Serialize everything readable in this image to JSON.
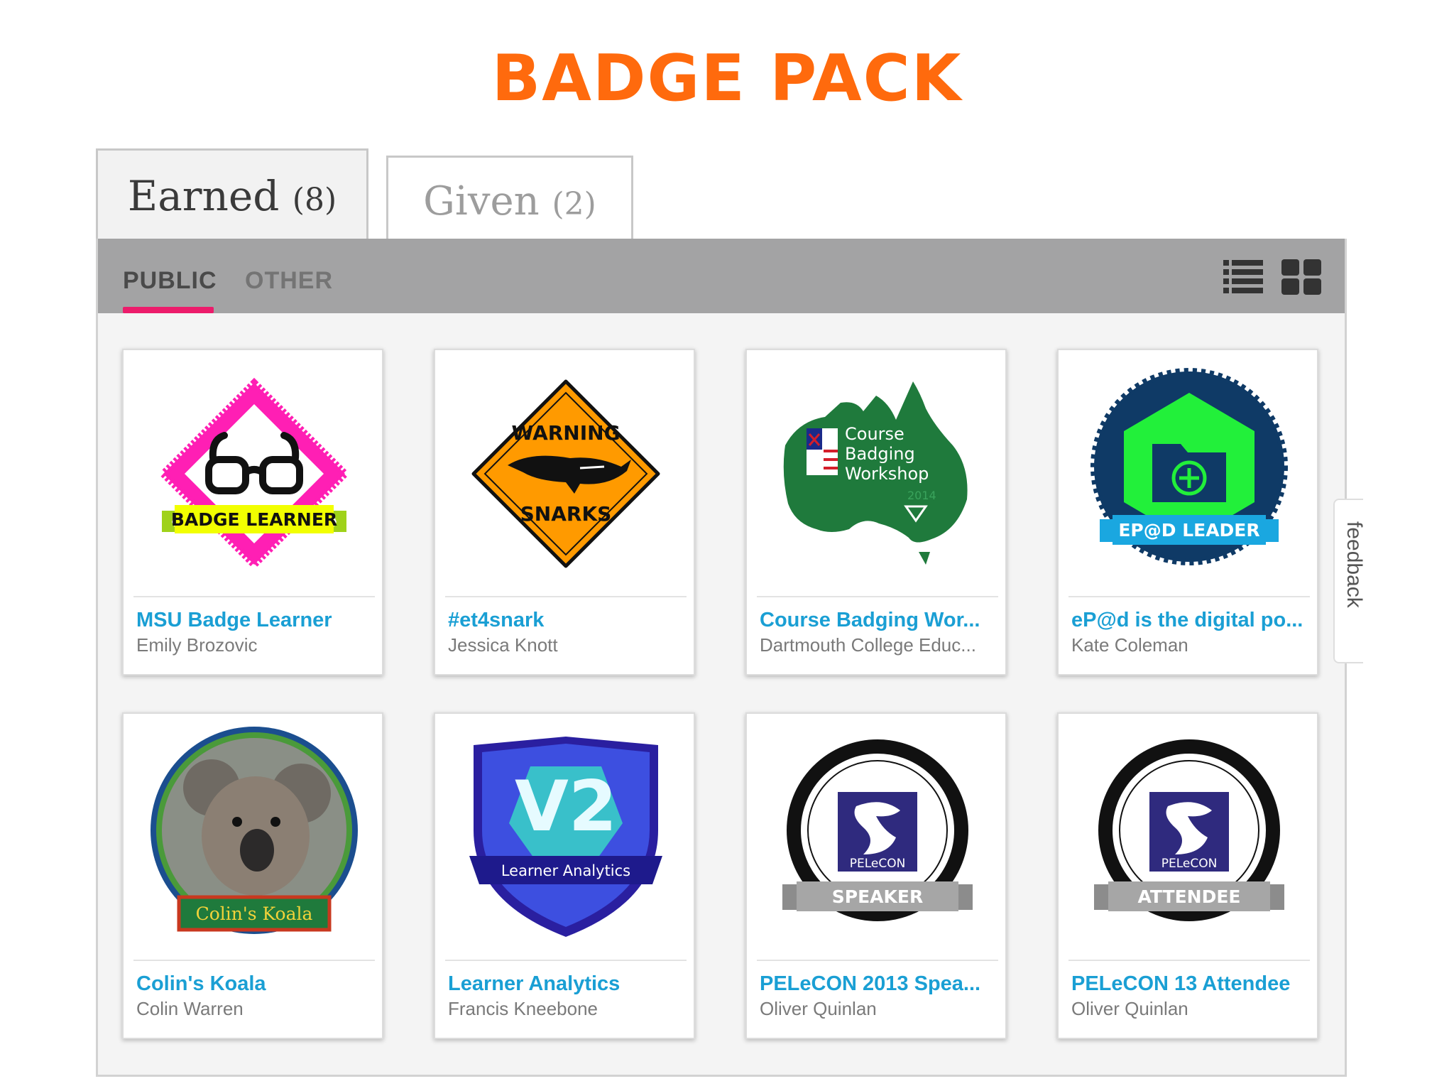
{
  "page": {
    "title": "BADGE PACK"
  },
  "tabs": [
    {
      "label": "Earned",
      "count": "(8)",
      "active": true
    },
    {
      "label": "Given",
      "count": "(2)",
      "active": false
    }
  ],
  "subtabs": [
    {
      "label": "PUBLIC",
      "active": true
    },
    {
      "label": "OTHER",
      "active": false
    }
  ],
  "view_toggle": {
    "list_icon": "list-view-icon",
    "grid_icon": "grid-view-icon"
  },
  "badges": [
    {
      "title": "MSU Badge Learner",
      "owner": "Emily Brozovic",
      "image": "badge-learner-diamond",
      "label": "BADGE LEARNER"
    },
    {
      "title": "#et4snark",
      "owner": "Jessica Knott",
      "image": "warning-snarks-sign",
      "line1": "WARNING",
      "line2": "SNARKS"
    },
    {
      "title": "Course Badging Wor...",
      "owner": "Dartmouth College Educ...",
      "image": "australia-map-badge",
      "line1": "Course",
      "line2": "Badging",
      "line3": "Workshop",
      "year": "2014"
    },
    {
      "title": "eP@d is the digital po...",
      "owner": "Kate Coleman",
      "image": "folder-plus-hexagon",
      "label": "EP@D LEADER"
    },
    {
      "title": "Colin's Koala",
      "owner": "Colin Warren",
      "image": "koala-photo-circle",
      "label": "Colin's Koala"
    },
    {
      "title": "Learner Analytics",
      "owner": "Francis Kneebone",
      "image": "v2-shield",
      "big": "V2",
      "label": "Learner Analytics"
    },
    {
      "title": "PELeCON 2013 Spea...",
      "owner": "Oliver Quinlan",
      "image": "pelecon-speaker-ring",
      "logo": "PELeCON",
      "label": "SPEAKER"
    },
    {
      "title": "PELeCON 13 Attendee",
      "owner": "Oliver Quinlan",
      "image": "pelecon-attendee-ring",
      "logo": "PELeCON",
      "label": "ATTENDEE"
    }
  ],
  "feedback": {
    "label": "feedback"
  },
  "colors": {
    "accent": "#ff6a0d",
    "underline": "#ec1c6b",
    "link": "#1a9fd4"
  }
}
